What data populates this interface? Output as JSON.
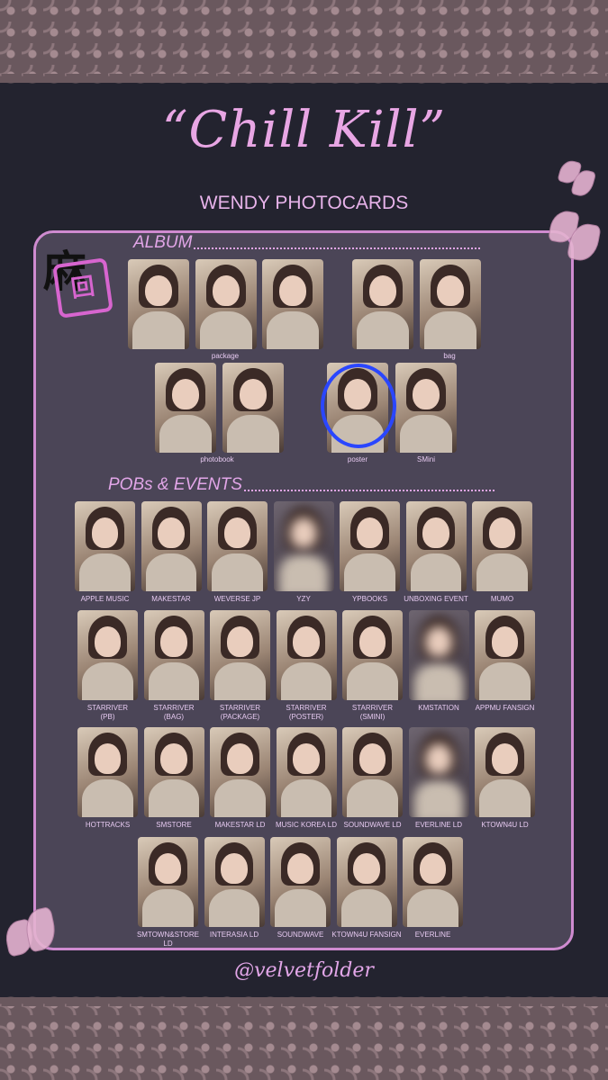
{
  "title": "“Chill Kill”",
  "subtitle": "WENDY PHOTOCARDS",
  "sections": {
    "album": "ALBUM",
    "pobs": "POBs & EVENTS"
  },
  "album_labels": {
    "package": "package",
    "bag": "bag",
    "photobook": "photobook",
    "poster": "poster",
    "smini": "SMini"
  },
  "pob_labels": [
    "APPLE MUSIC",
    "MAKESTAR",
    "WEVERSE JP",
    "YZY",
    "YPBOOKS",
    "UNBOXING EVENT",
    "MUMO",
    "STARRIVER\n(PB)",
    "STARRIVER\n(BAG)",
    "STARRIVER\n(PACKAGE)",
    "STARRIVER\n(POSTER)",
    "STARRIVER\n(SMINI)",
    "KMSTATION",
    "APPMU FANSIGN",
    "HOTTRACKS",
    "SMSTORE",
    "MAKESTAR LD",
    "MUSIC KOREA LD",
    "SOUNDWAVE LD",
    "EVERLINE LD",
    "KTOWN4U LD",
    "SMTOWN&STORE LD",
    "INTERASIA LD",
    "SOUNDWAVE",
    "KTOWN4U FANSIGN",
    "EVERLINE"
  ],
  "stamp": {
    "kanji": "麻",
    "seal": "回"
  },
  "handle": "@velvetfolder",
  "colors": {
    "background": "#23232f",
    "panel": "#4b4557",
    "accent": "#e2a6e8",
    "border": "#cf8bd0",
    "marker": "#2a46ff"
  }
}
